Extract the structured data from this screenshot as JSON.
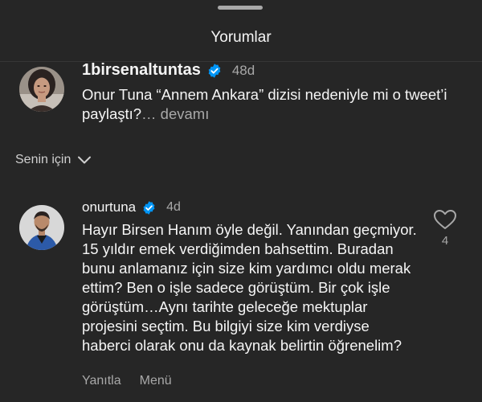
{
  "sheet": {
    "title": "Yorumlar"
  },
  "comments": [
    {
      "username": "1birsenaltuntas",
      "verified": true,
      "time": "48d",
      "text": "Onur Tuna “Annem Ankara” dizisi nedeniyle mi o tweet’i paylaştı?",
      "more": "… devamı"
    },
    {
      "username": "onurtuna",
      "verified": true,
      "time": "4d",
      "text": "Hayır Birsen Hanım öyle değil. Yanından geçmiyor. 15 yıldır emek verdiğimden bahsettim. Buradan bunu anlamanız için size kim yardımcı oldu merak ettim? Ben o işle sadece görüştüm.  Bir çok işle görüştüm…Aynı tarihte geleceğe mektuplar projesini seçtim. Bu bilgiyi size kim verdiyse haberci olarak onu da kaynak belirtin öğrenelim?",
      "likes": "4",
      "reply_label": "Yanıtla",
      "menu_label": "Menü"
    }
  ],
  "filter": {
    "label": "Senin için"
  },
  "colors": {
    "background": "#262626",
    "text_primary": "#f5f5f5",
    "text_secondary": "#a8a8a8",
    "verified_badge": "#0095f6"
  },
  "icons": {
    "verified": "verified-badge-icon",
    "chevron": "chevron-down-icon",
    "like": "heart-outline-icon"
  }
}
